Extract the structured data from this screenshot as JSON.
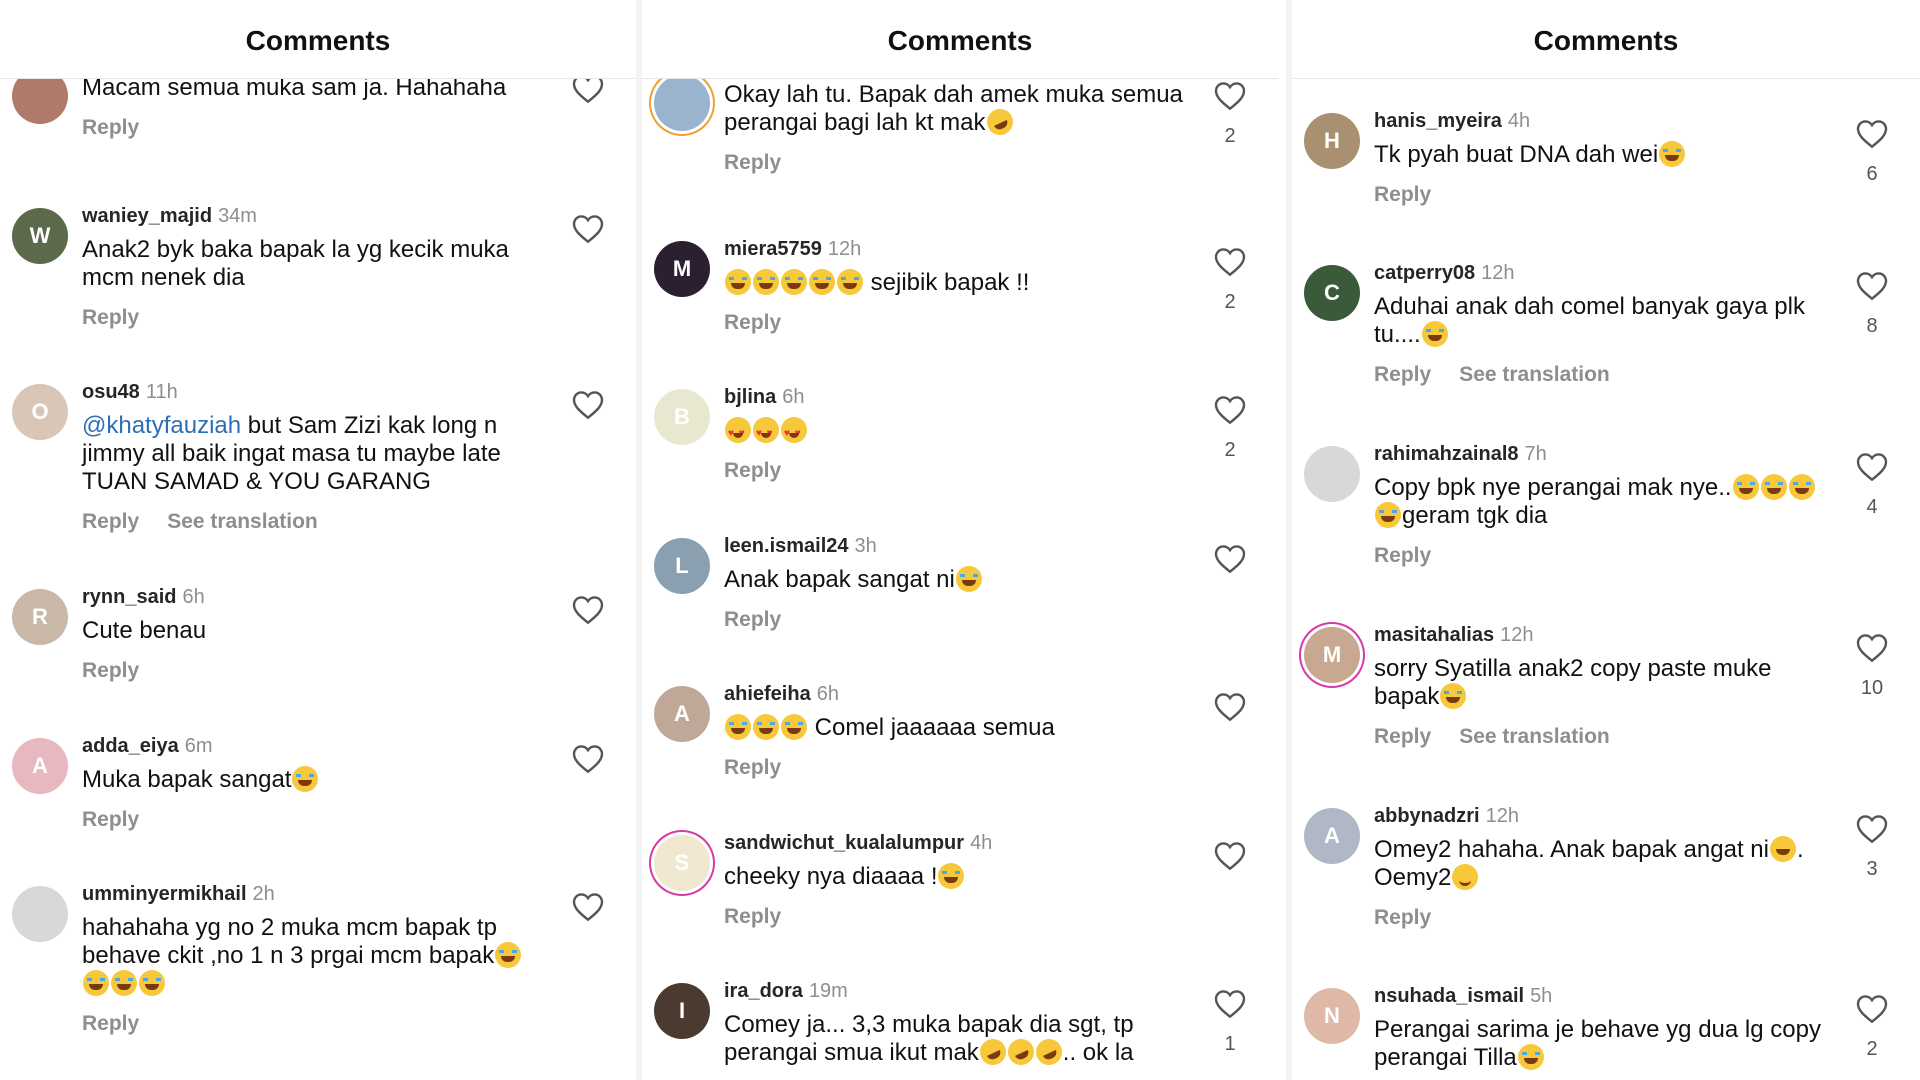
{
  "colors": {
    "mention": "#2d6fb4",
    "muted": "#8e8e8e",
    "story_ring": "#d83aa5"
  },
  "panels": [
    {
      "header": "Comments",
      "comments": [
        {
          "user": "",
          "time": "",
          "text": "Macam semua muka sam ja. Hahahaha",
          "actions": [
            "Reply"
          ],
          "likes": "",
          "avatar_color": "#b07a6a",
          "initial": ""
        },
        {
          "user": "waniey_majid",
          "time": "34m",
          "text": "Anak2 byk baka bapak la yg kecik muka mcm nenek dia",
          "actions": [
            "Reply"
          ],
          "likes": "",
          "avatar_color": "#5a6a4a",
          "initial": "W"
        },
        {
          "user": "osu48",
          "time": "11h",
          "mention": "@khatyfauziah",
          "text": " but Sam Zizi kak long n jimmy all baik  ingat masa tu maybe late TUAN SAMAD & YOU GARANG",
          "actions": [
            "Reply",
            "See translation"
          ],
          "likes": "",
          "avatar_color": "#d9c6b6",
          "initial": "O"
        },
        {
          "user": "rynn_said",
          "time": "6h",
          "text": "Cute benau",
          "actions": [
            "Reply"
          ],
          "likes": "",
          "avatar_color": "#c9b8a8",
          "initial": "R"
        },
        {
          "user": "adda_eiya",
          "time": "6m",
          "text": "Muka bapak sangat",
          "emojis": [
            "laugh"
          ],
          "actions": [
            "Reply"
          ],
          "likes": "",
          "avatar_color": "#e8b8c0",
          "initial": "A"
        },
        {
          "user": "umminyermikhail",
          "time": "2h",
          "text": "hahahaha  yg no 2 muka mcm bapak tp behave ckit ,no 1 n 3  prgai mcm bapak",
          "emojis": [
            "laugh",
            "laugh",
            "laugh",
            "laugh"
          ],
          "actions": [
            "Reply"
          ],
          "likes": "",
          "avatar_color": "#d8d8d8",
          "initial": ""
        }
      ]
    },
    {
      "header": "Comments",
      "comments": [
        {
          "user": "",
          "time": "",
          "text": "Okay lah tu. Bapak dah amek muka semua perangai bagi lah kt mak",
          "emojis": [
            "rofl"
          ],
          "actions": [
            "Reply"
          ],
          "likes": "2",
          "avatar_color": "#9ab4d0",
          "initial": ""
        },
        {
          "user": "miera5759",
          "time": "12h",
          "text": " sejibik bapak !!",
          "emojis_before": [
            "laugh",
            "laugh",
            "laugh",
            "laugh",
            "laugh"
          ],
          "actions": [
            "Reply"
          ],
          "likes": "2",
          "avatar_color": "#2a2030",
          "initial": "M"
        },
        {
          "user": "bjlina",
          "time": "6h",
          "text": "",
          "emojis": [
            "heart-eyes",
            "heart-eyes",
            "heart-eyes"
          ],
          "actions": [
            "Reply"
          ],
          "likes": "2",
          "avatar_color": "#e8e8d0",
          "initial": "B"
        },
        {
          "user": "leen.ismail24",
          "time": "3h",
          "text": "Anak bapak sangat ni",
          "emojis": [
            "laugh"
          ],
          "actions": [
            "Reply"
          ],
          "likes": "",
          "avatar_color": "#8aa0b0",
          "initial": "L"
        },
        {
          "user": "ahiefeiha",
          "time": "6h",
          "text": " Comel jaaaaaa semua",
          "emojis_before": [
            "laugh",
            "laugh",
            "laugh"
          ],
          "actions": [
            "Reply"
          ],
          "likes": "",
          "avatar_color": "#c0a898",
          "initial": "A"
        },
        {
          "user": "sandwichut_kualalumpur",
          "time": "4h",
          "text": "cheeky nya diaaaa !",
          "emojis": [
            "laugh"
          ],
          "actions": [
            "Reply"
          ],
          "likes": "",
          "avatar_color": "#f0e8d0",
          "initial": "S"
        },
        {
          "user": "ira_dora",
          "time": "19m",
          "text": "Comey ja... 3,3 muka bapak dia sgt, tp perangai smua ikut mak",
          "emojis": [
            "rofl",
            "rofl",
            "rofl"
          ],
          "text_after": ".. ok la",
          "actions": [
            "Reply"
          ],
          "likes": "1",
          "avatar_color": "#4a3a30",
          "initial": "I"
        }
      ]
    },
    {
      "header": "Comments",
      "comments": [
        {
          "user": "hanis_myeira",
          "time": "4h",
          "text": "Tk pyah buat DNA dah wei",
          "emojis": [
            "laugh"
          ],
          "actions": [
            "Reply"
          ],
          "likes": "6",
          "avatar_color": "#a89070",
          "initial": "H"
        },
        {
          "user": "catperry08",
          "time": "12h",
          "text": "Aduhai anak dah comel banyak gaya plk tu....",
          "emojis": [
            "laugh"
          ],
          "actions": [
            "Reply",
            "See translation"
          ],
          "likes": "8",
          "avatar_color": "#3a5a3a",
          "initial": "C"
        },
        {
          "user": "rahimahzainal8",
          "time": "7h",
          "text": "Copy bpk nye perangai mak nye..",
          "emojis": [
            "laugh",
            "laugh",
            "laugh",
            "laugh"
          ],
          "text_after": "geram tgk dia",
          "actions": [
            "Reply"
          ],
          "likes": "4",
          "avatar_color": "#d8d8d8",
          "initial": ""
        },
        {
          "user": "masitahalias",
          "time": "12h",
          "text": "sorry Syatilla anak2 copy paste muke bapak",
          "emojis": [
            "laugh"
          ],
          "actions": [
            "Reply",
            "See translation"
          ],
          "likes": "10",
          "avatar_color": "#c8a890",
          "initial": "M"
        },
        {
          "user": "abbynadzri",
          "time": "12h",
          "text": "Omey2 hahaha. Anak bapak angat ni",
          "emojis": [
            "grin"
          ],
          "text_after": ". Oemy2",
          "emojis_after": [
            "smile"
          ],
          "actions": [
            "Reply"
          ],
          "likes": "3",
          "avatar_color": "#b0b8c8",
          "initial": "A"
        },
        {
          "user": "nsuhada_ismail",
          "time": "5h",
          "text": "Perangai sarima je behave yg dua lg copy perangai Tilla",
          "emojis": [
            "laugh"
          ],
          "actions": [
            "Reply"
          ],
          "likes": "2",
          "avatar_color": "#e0b8a8",
          "initial": "N"
        }
      ]
    }
  ]
}
